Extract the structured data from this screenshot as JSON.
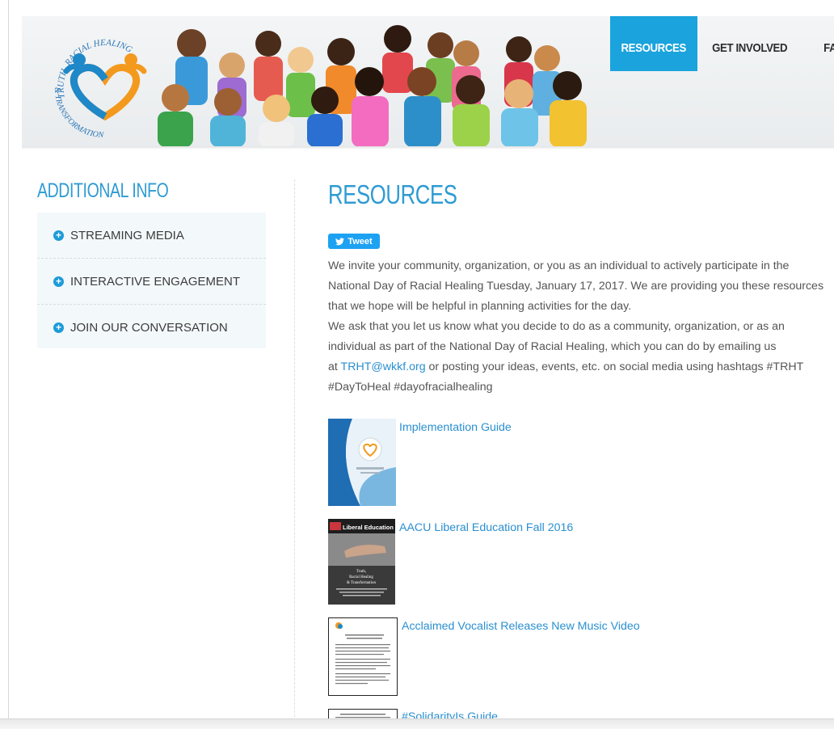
{
  "logo": {
    "arc_text_top": "TRUTH, RACIAL HEALING",
    "arc_text_bottom": "& TRANSFORMATION",
    "colors": {
      "blue": "#1e88c8",
      "orange": "#f39a1e"
    }
  },
  "nav": {
    "items": [
      {
        "label": "RESOURCES",
        "active": true
      },
      {
        "label": "GET INVOLVED",
        "active": false
      },
      {
        "label": "FAQ",
        "active": false
      }
    ],
    "accent": "#1aa3dc"
  },
  "sidebar": {
    "title": "ADDITIONAL INFO",
    "items": [
      {
        "label": "STREAMING MEDIA"
      },
      {
        "label": "INTERACTIVE ENGAGEMENT"
      },
      {
        "label": "JOIN OUR CONVERSATION"
      }
    ]
  },
  "main": {
    "title": "RESOURCES",
    "tweet_label": "Tweet",
    "lines": [
      "We invite your community, organization, or you as an individual to actively participate in the",
      "National Day of Racial Healing Tuesday, January 17, 2017. We are providing you these resources",
      "that we hope will be helpful in planning activities for the day.",
      "We ask that you let us know what you decide to do as a community, organization, or as an",
      "individual as part of the National Day of Racial Healing, which you can do by emailing us"
    ],
    "line6_prefix": "at ",
    "email": "TRHT@wkkf.org",
    "line6_suffix": " or posting your ideas, events, etc. on social media using hashtags #TRHT",
    "line7": "#DayToHeal #dayofracialhealing",
    "resources": [
      {
        "label": "Implementation Guide"
      },
      {
        "label": "AACU Liberal Education Fall 2016",
        "thumb_text": [
          "Liberal Education",
          "Truth,",
          "Racial Healing",
          "& Transformation"
        ]
      },
      {
        "label": "Acclaimed Vocalist Releases New Music Video"
      },
      {
        "label": "#SolidarityIs Guide"
      }
    ],
    "link_color": "#2a8fd0"
  }
}
